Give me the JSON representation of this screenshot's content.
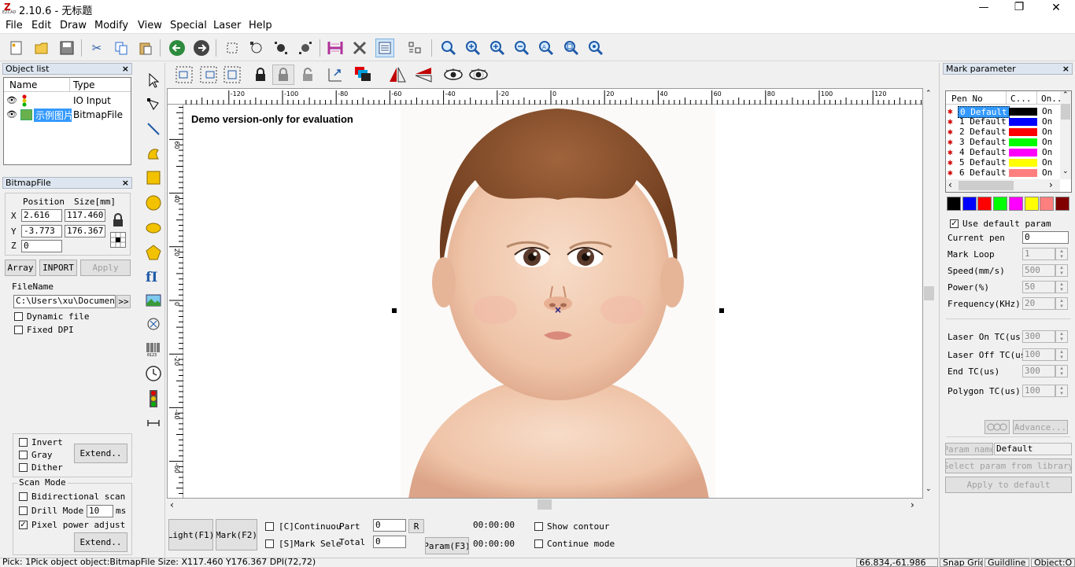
{
  "window": {
    "title": "2.10.6 - 无标题",
    "app_logo_text": "EZCAD",
    "minimize": "—",
    "maximize": "❐",
    "close": "✕"
  },
  "menu": [
    "File",
    "Edit",
    "Draw",
    "Modify",
    "View",
    "Special",
    "Laser",
    "Help"
  ],
  "object_list": {
    "title": "Object list",
    "columns": [
      "Name",
      "Type"
    ],
    "rows": [
      {
        "name": "",
        "type": "IO Input"
      },
      {
        "name": "示例图片",
        "type": "BitmapFile"
      }
    ]
  },
  "bitmap_panel": {
    "title": "BitmapFile",
    "position_header": "Position",
    "size_header": "Size[mm]",
    "x_label": "X",
    "y_label": "Y",
    "z_label": "Z",
    "x_pos": "2.616",
    "y_pos": "-3.773",
    "z_pos": "0",
    "x_size": "117.460",
    "y_size": "176.367",
    "array_button": "Array",
    "import_button": "INPORT",
    "apply_button": "Apply",
    "filename_label": "FileName",
    "filename_value": "C:\\Users\\xu\\Documents",
    "browse_button": ">>",
    "dynamic_file": {
      "label": "Dynamic file",
      "checked": false
    },
    "fixed_dpi": {
      "label": "Fixed DPI",
      "checked": false
    },
    "invert": {
      "label": "Invert",
      "checked": false
    },
    "gray": {
      "label": "Gray",
      "checked": false
    },
    "dither": {
      "label": "Dither",
      "checked": false
    },
    "extend_button_1": "Extend..",
    "scan_mode_label": "Scan Mode",
    "bidirectional": {
      "label": "Bidirectional scan",
      "checked": false
    },
    "drill_mode": {
      "label": "Drill Mode",
      "checked": false
    },
    "drill_value": "10",
    "drill_unit": "ms",
    "pixel_power": {
      "label": "Pixel power adjust",
      "checked": true
    },
    "extend_button_2": "Extend.."
  },
  "canvas": {
    "watermark": "Demo version-only for evaluation",
    "ruler_top_labels": [
      "-120",
      "-100",
      "-80",
      "-60",
      "-40",
      "-20",
      "0",
      "20",
      "40",
      "60",
      "80",
      "100",
      "120"
    ],
    "ruler_left_labels": [
      "60",
      "40",
      "20",
      "0",
      "-20",
      "-40",
      "-60"
    ],
    "center_mark": "×"
  },
  "bottom_controls": {
    "light_button": "Light(F1)",
    "mark_button": "Mark(F2)",
    "continuous": {
      "label": "[C]Continuou",
      "checked": false
    },
    "mark_selected": {
      "label": "[S]Mark Sele",
      "checked": false
    },
    "part_label": "Part",
    "part_value": "0",
    "reset_button": "R",
    "total_label": "Total",
    "total_value": "0",
    "time1": "00:00:00",
    "time2": "00:00:00",
    "param_button": "Param(F3)",
    "show_contour": {
      "label": "Show contour",
      "checked": false
    },
    "continue_mode": {
      "label": "Continue mode",
      "checked": false
    }
  },
  "mark_parameter": {
    "title": "Mark parameter",
    "columns": [
      "Pen No",
      "C...",
      "On..."
    ],
    "pens": [
      {
        "label": "0 Default",
        "color": "#000000",
        "on": "On"
      },
      {
        "label": "1 Default",
        "color": "#0000ff",
        "on": "On"
      },
      {
        "label": "2 Default",
        "color": "#ff0000",
        "on": "On"
      },
      {
        "label": "3 Default",
        "color": "#00ff00",
        "on": "On"
      },
      {
        "label": "4 Default",
        "color": "#ff00ff",
        "on": "On"
      },
      {
        "label": "5 Default",
        "color": "#ffff00",
        "on": "On"
      },
      {
        "label": "6 Default",
        "color": "#ff7f7f",
        "on": "On"
      }
    ],
    "swatches": [
      "#000000",
      "#0000ff",
      "#ff0000",
      "#00ff00",
      "#ff00ff",
      "#ffff00",
      "#ff7f7f",
      "#800000"
    ],
    "use_default": {
      "label": "Use default param",
      "checked": true
    },
    "current_pen_label": "Current pen",
    "current_pen": "0",
    "mark_loop_label": "Mark Loop",
    "mark_loop": "1",
    "speed_label": "Speed(mm/s)",
    "speed": "500",
    "power_label": "Power(%)",
    "power": "50",
    "frequency_label": "Frequency(KHz)",
    "frequency": "20",
    "laser_on_label": "Laser On TC(us)",
    "laser_on": "300",
    "laser_off_label": "Laser Off TC(us",
    "laser_off": "100",
    "end_tc_label": "End TC(us)",
    "end_tc": "300",
    "polygon_label": "Polygon TC(us)",
    "polygon": "100",
    "advance_button": "Advance...",
    "param_name_label": "Param name",
    "param_name_value": "Default",
    "select_param_button": "Select param from library",
    "apply_default_button": "Apply to default"
  },
  "status": {
    "message": "Pick: 1Pick object object:BitmapFile Size: X117.460 Y176.367 DPI(72,72)",
    "coords": "66.834,-61.986",
    "snap_grid": "Snap Grid",
    "guideline": "Guildline",
    "object": "Object:O"
  }
}
